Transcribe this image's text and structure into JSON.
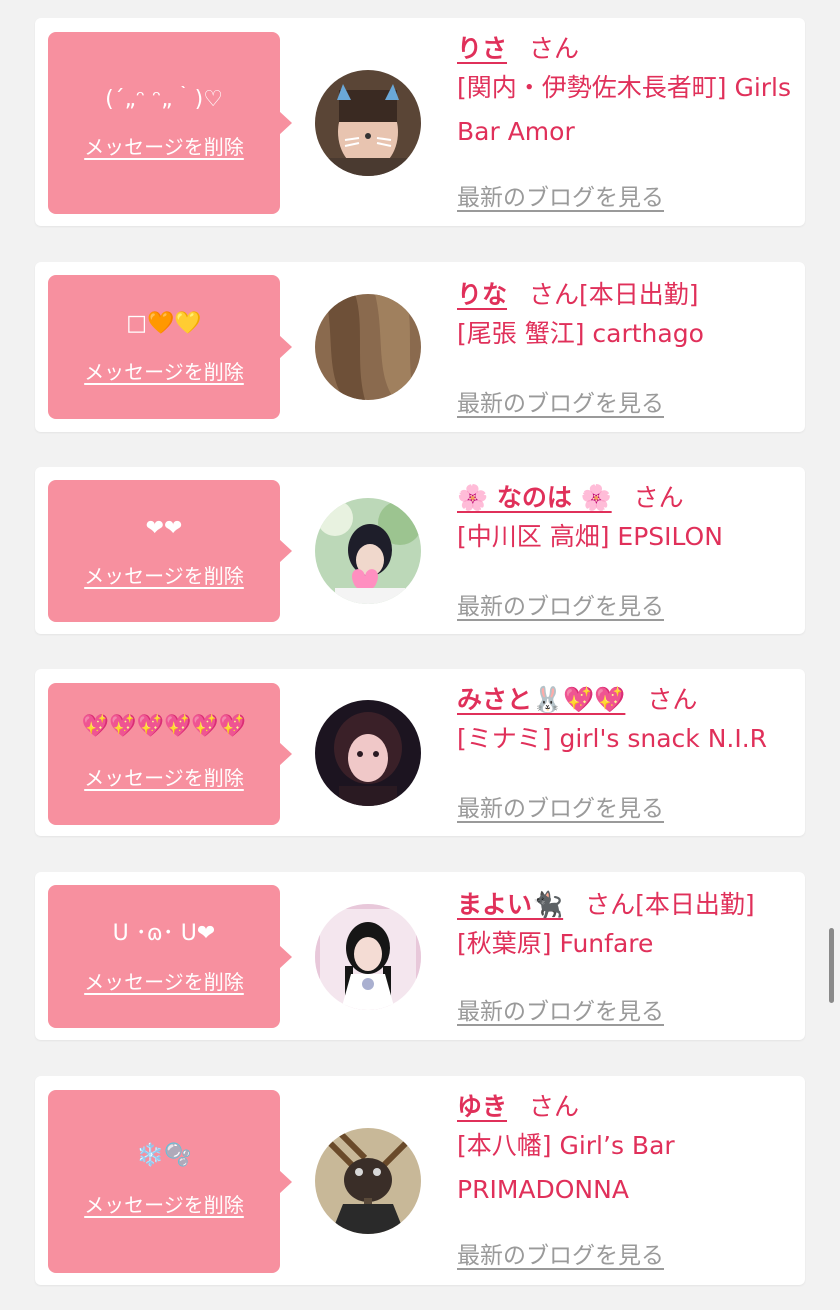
{
  "delete_label": "メッセージを削除",
  "blog_label": "最新のブログを見る",
  "san_label": "さん",
  "colors": {
    "bubble": "#f7909f",
    "accent": "#e0305a",
    "link_gray": "#9a9a9a",
    "background": "#f2f2f2"
  },
  "cards": [
    {
      "message": "(´„ᵔ ᵔ„｀)♡",
      "name": "りさ",
      "status": "",
      "shop": "[関内・伊勢佐木長者町] Girls Bar Amor",
      "avatar_icon": "avatar-photo-cat-filter"
    },
    {
      "message": "□🧡💛",
      "name": "りな",
      "status": "[本日出勤]",
      "shop": "[尾張 蟹江] carthago",
      "avatar_icon": "avatar-photo-hair"
    },
    {
      "message": "❤❤",
      "name": "🌸 なのは 🌸",
      "status": "",
      "shop": "[中川区 高畑] EPSILON",
      "avatar_icon": "avatar-photo-heart"
    },
    {
      "message": "💖💖💖💖💖💖",
      "name": "みさと🐰💖💖",
      "status": "",
      "shop": "[ミナミ] girl's snack N.I.R",
      "avatar_icon": "avatar-photo-girl"
    },
    {
      "message": "U ･ɷ･ U❤",
      "name": "まよい🐈‍⬛",
      "status": "[本日出勤]",
      "shop": "[秋葉原] Funfare",
      "avatar_icon": "avatar-photo-idol"
    },
    {
      "message": "❄️🫧",
      "name": "ゆき",
      "status": "",
      "shop": "[本八幡] Girl’s Bar PRIMADONNA",
      "avatar_icon": "avatar-photo-braids"
    }
  ]
}
